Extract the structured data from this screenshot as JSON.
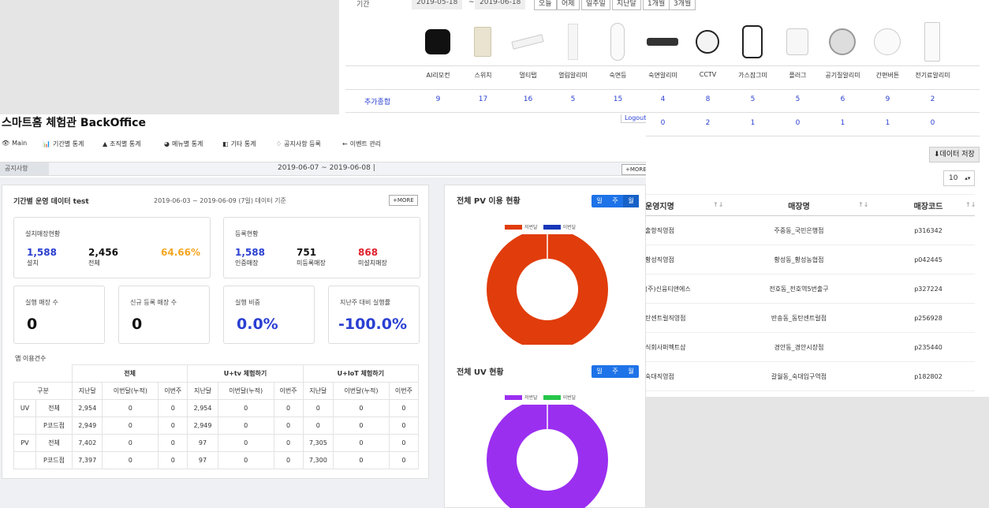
{
  "back": {
    "period_label": "기간",
    "date_from": "2019-05-18",
    "date_sep": "~",
    "date_to": "2019-06-18",
    "quick_buttons": [
      "오늘",
      "어제",
      "일주일",
      "지난달",
      "1개월",
      "3개월"
    ],
    "row_label": "추가종합",
    "products": [
      {
        "name": "AI리모컨",
        "v1": "9",
        "v2": "",
        "icon": "ai-remote-icon"
      },
      {
        "name": "스위치",
        "v1": "17",
        "v2": "",
        "icon": "switch-icon"
      },
      {
        "name": "멀티탭",
        "v1": "16",
        "v2": "0",
        "icon": "power-strip-icon"
      },
      {
        "name": "열림알리미",
        "v1": "5",
        "v2": "",
        "icon": "door-sensor-icon"
      },
      {
        "name": "숙면등",
        "v1": "15",
        "v2": "",
        "icon": "sleep-lamp-icon"
      },
      {
        "name": "숙면알리미",
        "v1": "4",
        "v2": "0",
        "icon": "sleep-sensor-icon"
      },
      {
        "name": "CCTV",
        "v1": "8",
        "v2": "2",
        "icon": "cctv-icon"
      },
      {
        "name": "가스잠그미",
        "v1": "5",
        "v2": "1",
        "icon": "gas-lock-icon"
      },
      {
        "name": "플러그",
        "v1": "5",
        "v2": "0",
        "icon": "plug-icon"
      },
      {
        "name": "공기질알리미",
        "v1": "6",
        "v2": "1",
        "icon": "air-quality-icon"
      },
      {
        "name": "간편버튼",
        "v1": "9",
        "v2": "1",
        "icon": "simple-button-icon"
      },
      {
        "name": "전기료알리미",
        "v1": "2",
        "v2": "0",
        "icon": "power-meter-icon"
      }
    ],
    "save_button": "데이터 저장",
    "page_size": "10",
    "store_table": {
      "headers": [
        "운영지명",
        "매장명",
        "매장코드"
      ],
      "rows": [
        [
          "출항직영점",
          "주중동_국민은행점",
          "p316342"
        ],
        [
          "황성직영점",
          "황성동_황성농협점",
          "p042445"
        ],
        [
          "(주)신융티앤에스",
          "전호동_전호역5번출구",
          "p327224"
        ],
        [
          "탄센트럴직영점",
          "반송동_동탄센트럴점",
          "p256928"
        ],
        [
          "식회사퍼펙트샵",
          "경안동_경안시장점",
          "p235440"
        ],
        [
          "숙대직영점",
          "갈월동_숙대입구역점",
          "p182802"
        ]
      ]
    }
  },
  "front": {
    "title": "스마트홈 체험관 BackOffice",
    "logout": "Logout",
    "nav": [
      "Main",
      "기간별 통계",
      "조직별 통계",
      "메뉴별 통계",
      "기타 통계",
      "공지사항 등록",
      "이벤트 관리"
    ],
    "notice_tab": "공지사항",
    "notice_date": "2019-06-07 ~ 2019-06-08  |",
    "more": "+MORE",
    "left_card": {
      "title": "기간별 운영 데이터 test",
      "period": "2019-06-03 ~ 2019-06-09 (7일) 데이터 기준",
      "more": "+MORE",
      "install": {
        "title": "설치매장현황",
        "installed": "1,588",
        "installed_cap": "설치",
        "total": "2,456",
        "total_cap": "전체",
        "rate": "64.66%"
      },
      "register": {
        "title": "등록현황",
        "auth": "1,588",
        "auth_cap": "인증매장",
        "unreg": "751",
        "unreg_cap": "미등록매장",
        "uninstalled": "868",
        "uninstalled_cap": "미설치매장"
      },
      "kpis": [
        {
          "title": "실행 매장 수",
          "value": "0"
        },
        {
          "title": "신규 등록 매장 수",
          "value": "0"
        },
        {
          "title": "실행 비중",
          "value": "0.0%"
        },
        {
          "title": "지난주 대비 실행률",
          "value": "-100.0%"
        }
      ],
      "usage_label": "앱 이용건수",
      "table": {
        "groups": [
          "전체",
          "U+tv 체험하기",
          "U+IoT 체험하기"
        ],
        "col_div": "구분",
        "sub_headers": [
          "지난달",
          "이번달(누적)",
          "이번주"
        ],
        "rows": [
          {
            "type": "UV",
            "sub": "전체",
            "vals": [
              "2,954",
              "0",
              "0",
              "2,954",
              "0",
              "0",
              "0",
              "0",
              "0"
            ]
          },
          {
            "type": "",
            "sub": "P코드점",
            "vals": [
              "2,949",
              "0",
              "0",
              "2,949",
              "0",
              "0",
              "0",
              "0",
              "0"
            ]
          },
          {
            "type": "PV",
            "sub": "전체",
            "vals": [
              "7,402",
              "0",
              "0",
              "97",
              "0",
              "0",
              "7,305",
              "0",
              "0"
            ]
          },
          {
            "type": "",
            "sub": "P코드점",
            "vals": [
              "7,397",
              "0",
              "0",
              "97",
              "0",
              "0",
              "7,300",
              "0",
              "0"
            ]
          }
        ]
      }
    },
    "right_card": {
      "pv_title": "전체 PV 이용 현황",
      "uv_title": "전체 UV 현황",
      "toggle": [
        "일",
        "주",
        "월"
      ],
      "legend_prev": "저번달",
      "legend_curr": "이번달",
      "colors": {
        "pv_prev": "#e13c0b",
        "pv_curr": "#1737b8",
        "uv_prev": "#9b2ff0",
        "uv_curr": "#27c64b"
      }
    }
  }
}
